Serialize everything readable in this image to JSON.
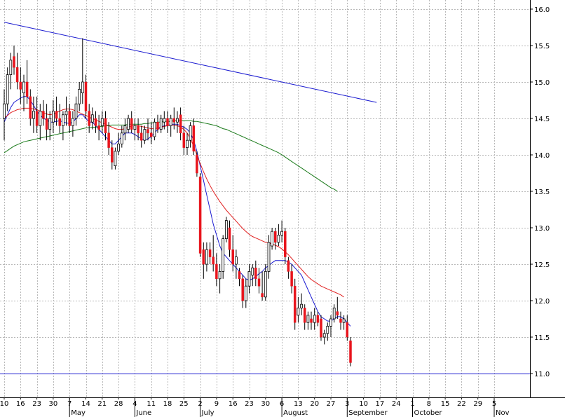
{
  "chart_data": {
    "type": "candlestick",
    "grid": true,
    "colors": {
      "up_candle": "#ffffff",
      "down_candle": "#e8141c",
      "ma_short": "#1a1ad0",
      "ma_mid": "#e02020",
      "ma_long": "#1a7a1a",
      "trendline": "#1a1ad0",
      "support_line": "#1a1ad0",
      "grid": "#b8b8b8"
    },
    "y_axis": {
      "ylim": [
        10.9,
        16.15
      ],
      "tick_labels": [
        "11.0",
        "11.5",
        "12.0",
        "12.5",
        "13.0",
        "13.5",
        "14.0",
        "14.5",
        "15.0",
        "15.5",
        "16.0"
      ],
      "tick_values": [
        11.0,
        11.5,
        12.0,
        12.5,
        13.0,
        13.5,
        14.0,
        14.5,
        15.0,
        15.5,
        16.0
      ]
    },
    "x_axis": {
      "day_labels": [
        "10",
        "16",
        "23",
        "30",
        "7",
        "14",
        "21",
        "28",
        "4",
        "11",
        "18",
        "25",
        "2",
        "9",
        "16",
        "23",
        "30",
        "6",
        "13",
        "20",
        "27",
        "3",
        "10",
        "17",
        "24",
        "1",
        "8",
        "15",
        "22",
        "29",
        "5"
      ],
      "month_labels": [
        {
          "label": "May",
          "day_index": 4
        },
        {
          "label": "June",
          "day_index": 8
        },
        {
          "label": "July",
          "day_index": 12
        },
        {
          "label": "August",
          "day_index": 17
        },
        {
          "label": "September",
          "day_index": 21
        },
        {
          "label": "October",
          "day_index": 25
        },
        {
          "label": "Nov",
          "day_index": 30
        }
      ],
      "bars_per_week": 5
    },
    "candles": [
      [
        14.5,
        14.9,
        14.2,
        14.7
      ],
      [
        14.7,
        15.2,
        14.6,
        15.1
      ],
      [
        15.1,
        15.4,
        14.9,
        15.3
      ],
      [
        15.35,
        15.5,
        15.1,
        15.2
      ],
      [
        15.2,
        15.4,
        14.9,
        15.0
      ],
      [
        15.0,
        15.2,
        14.7,
        14.9
      ],
      [
        14.85,
        15.1,
        14.6,
        15.0
      ],
      [
        15.0,
        15.3,
        14.7,
        14.8
      ],
      [
        14.8,
        14.9,
        14.4,
        14.5
      ],
      [
        14.5,
        14.8,
        14.3,
        14.6
      ],
      [
        14.6,
        14.8,
        14.3,
        14.4
      ],
      [
        14.4,
        14.7,
        14.2,
        14.6
      ],
      [
        14.6,
        14.75,
        14.4,
        14.5
      ],
      [
        14.5,
        14.7,
        14.2,
        14.35
      ],
      [
        14.35,
        14.6,
        14.2,
        14.5
      ],
      [
        14.45,
        14.75,
        14.3,
        14.6
      ],
      [
        14.6,
        14.8,
        14.4,
        14.5
      ],
      [
        14.5,
        14.7,
        14.3,
        14.4
      ],
      [
        14.4,
        14.6,
        14.2,
        14.55
      ],
      [
        14.55,
        14.8,
        14.4,
        14.6
      ],
      [
        14.6,
        14.7,
        14.3,
        14.4
      ],
      [
        14.4,
        14.6,
        14.25,
        14.5
      ],
      [
        14.5,
        14.8,
        14.4,
        14.7
      ],
      [
        14.7,
        15.0,
        14.6,
        14.9
      ],
      [
        14.85,
        15.6,
        14.7,
        15.0
      ],
      [
        15.0,
        15.1,
        14.5,
        14.6
      ],
      [
        14.6,
        14.7,
        14.3,
        14.4
      ],
      [
        14.45,
        14.65,
        14.35,
        14.55
      ],
      [
        14.5,
        14.6,
        14.3,
        14.4
      ],
      [
        14.4,
        14.55,
        14.2,
        14.35
      ],
      [
        14.4,
        14.6,
        14.3,
        14.5
      ],
      [
        14.5,
        14.6,
        14.2,
        14.3
      ],
      [
        14.3,
        14.45,
        14.0,
        14.1
      ],
      [
        14.1,
        14.2,
        13.8,
        13.9
      ],
      [
        13.85,
        14.1,
        13.8,
        14.05
      ],
      [
        14.05,
        14.3,
        14.0,
        14.15
      ],
      [
        14.15,
        14.4,
        14.1,
        14.3
      ],
      [
        14.3,
        14.5,
        14.2,
        14.4
      ],
      [
        14.35,
        14.55,
        14.3,
        14.5
      ],
      [
        14.5,
        14.6,
        14.3,
        14.35
      ],
      [
        14.35,
        14.5,
        14.2,
        14.4
      ],
      [
        14.4,
        14.5,
        14.2,
        14.3
      ],
      [
        14.3,
        14.4,
        14.1,
        14.2
      ],
      [
        14.2,
        14.4,
        14.15,
        14.35
      ],
      [
        14.35,
        14.5,
        14.2,
        14.3
      ],
      [
        14.3,
        14.45,
        14.15,
        14.25
      ],
      [
        14.25,
        14.5,
        14.2,
        14.45
      ],
      [
        14.45,
        14.55,
        14.3,
        14.35
      ],
      [
        14.35,
        14.55,
        14.3,
        14.5
      ],
      [
        14.45,
        14.6,
        14.35,
        14.5
      ],
      [
        14.5,
        14.6,
        14.3,
        14.4
      ],
      [
        14.4,
        14.55,
        14.25,
        14.5
      ],
      [
        14.5,
        14.65,
        14.35,
        14.45
      ],
      [
        14.45,
        14.6,
        14.3,
        14.5
      ],
      [
        14.55,
        14.65,
        14.2,
        14.3
      ],
      [
        14.3,
        14.4,
        14.0,
        14.1
      ],
      [
        14.1,
        14.3,
        14.0,
        14.2
      ],
      [
        14.2,
        14.45,
        14.1,
        14.4
      ],
      [
        14.4,
        14.5,
        14.0,
        14.05
      ],
      [
        14.0,
        14.05,
        13.7,
        13.75
      ],
      [
        13.7,
        13.75,
        12.6,
        12.65
      ],
      [
        12.7,
        12.8,
        12.3,
        12.5
      ],
      [
        12.5,
        12.8,
        12.4,
        12.7
      ],
      [
        12.7,
        12.8,
        12.5,
        12.6
      ],
      [
        12.6,
        12.9,
        12.4,
        12.5
      ],
      [
        12.5,
        12.65,
        12.2,
        12.3
      ],
      [
        12.3,
        12.5,
        12.1,
        12.4
      ],
      [
        12.4,
        12.9,
        12.3,
        12.85
      ],
      [
        12.85,
        13.15,
        12.8,
        13.1
      ],
      [
        13.0,
        13.1,
        12.6,
        12.7
      ],
      [
        12.7,
        12.9,
        12.4,
        12.5
      ],
      [
        12.5,
        12.7,
        12.3,
        12.6
      ],
      [
        12.4,
        12.45,
        12.2,
        12.3
      ],
      [
        12.3,
        12.35,
        11.9,
        12.0
      ],
      [
        12.0,
        12.3,
        11.9,
        12.2
      ],
      [
        12.2,
        12.5,
        12.1,
        12.4
      ],
      [
        12.35,
        12.5,
        12.2,
        12.45
      ],
      [
        12.45,
        12.55,
        12.2,
        12.3
      ],
      [
        12.3,
        12.45,
        12.1,
        12.2
      ],
      [
        12.1,
        12.4,
        12.0,
        12.05
      ],
      [
        12.05,
        12.5,
        12.0,
        12.4
      ],
      [
        12.4,
        12.9,
        12.3,
        12.8
      ],
      [
        12.75,
        13.0,
        12.7,
        12.95
      ],
      [
        12.95,
        13.0,
        12.7,
        12.8
      ],
      [
        12.8,
        13.05,
        12.75,
        12.9
      ],
      [
        12.9,
        13.1,
        12.8,
        12.95
      ],
      [
        12.95,
        13.0,
        12.5,
        12.6
      ],
      [
        12.55,
        12.6,
        12.3,
        12.4
      ],
      [
        12.4,
        12.5,
        12.1,
        12.2
      ],
      [
        12.2,
        12.3,
        11.6,
        11.7
      ],
      [
        11.8,
        12.05,
        11.7,
        11.9
      ],
      [
        11.9,
        12.1,
        11.8,
        11.95
      ],
      [
        11.9,
        11.95,
        11.6,
        11.7
      ],
      [
        11.7,
        11.85,
        11.6,
        11.8
      ],
      [
        11.75,
        11.85,
        11.6,
        11.7
      ],
      [
        11.7,
        11.9,
        11.6,
        11.8
      ],
      [
        11.8,
        11.85,
        11.65,
        11.7
      ],
      [
        11.75,
        11.8,
        11.45,
        11.5
      ],
      [
        11.5,
        11.6,
        11.4,
        11.55
      ],
      [
        11.55,
        11.7,
        11.45,
        11.65
      ],
      [
        11.65,
        11.8,
        11.5,
        11.75
      ],
      [
        11.75,
        11.95,
        11.7,
        11.9
      ],
      [
        11.85,
        12.05,
        11.75,
        11.8
      ],
      [
        11.75,
        11.85,
        11.6,
        11.7
      ],
      [
        11.7,
        11.8,
        11.6,
        11.75
      ],
      [
        11.7,
        11.8,
        11.45,
        11.5
      ],
      [
        11.45,
        11.5,
        11.1,
        11.15
      ]
    ],
    "moving_averages": [
      {
        "color_key": "ma_short",
        "start_index": 0,
        "values": [
          14.45,
          14.55,
          14.65,
          14.72,
          14.75,
          14.78,
          14.8,
          14.8,
          14.75,
          14.68,
          14.6,
          14.55,
          14.5,
          14.48,
          14.45,
          14.45,
          14.46,
          14.47,
          14.45,
          14.44,
          14.43,
          14.45,
          14.5,
          14.55,
          14.55,
          14.5,
          14.45,
          14.45,
          14.4,
          14.35,
          14.3,
          14.25,
          14.2,
          14.15,
          14.15,
          14.2,
          14.25,
          14.3,
          14.3,
          14.3,
          14.28,
          14.25,
          14.22,
          14.2,
          14.22,
          14.25,
          14.3,
          14.35,
          14.38,
          14.4,
          14.4,
          14.42,
          14.42,
          14.42,
          14.4,
          14.38,
          14.35,
          14.3,
          14.2,
          14.05,
          13.85,
          13.65,
          13.45,
          13.25,
          13.05,
          12.9,
          12.75,
          12.65,
          12.6,
          12.55,
          12.5,
          12.45,
          12.4,
          12.35,
          12.3,
          12.28,
          12.3,
          12.33,
          12.37,
          12.4,
          12.45,
          12.48,
          12.52,
          12.55,
          12.55,
          12.55,
          12.55,
          12.53,
          12.5,
          12.45,
          12.4,
          12.35,
          12.25,
          12.15,
          12.05,
          11.95,
          11.85,
          11.78,
          11.75,
          11.72,
          11.72,
          11.75,
          11.78,
          11.78,
          11.75,
          11.7,
          11.65
        ]
      },
      {
        "color_key": "ma_mid",
        "start_index": 0,
        "values": [
          14.5,
          14.54,
          14.58,
          14.6,
          14.62,
          14.63,
          14.64,
          14.64,
          14.64,
          14.63,
          14.62,
          14.6,
          14.58,
          14.56,
          14.55,
          14.56,
          14.58,
          14.6,
          14.62,
          14.63,
          14.63,
          14.62,
          14.6,
          14.58,
          14.56,
          14.54,
          14.52,
          14.5,
          14.48,
          14.46,
          14.44,
          14.42,
          14.4,
          14.38,
          14.36,
          14.35,
          14.35,
          14.36,
          14.38,
          14.4,
          14.4,
          14.4,
          14.39,
          14.38,
          14.37,
          14.36,
          14.36,
          14.37,
          14.38,
          14.39,
          14.4,
          14.41,
          14.41,
          14.4,
          14.38,
          14.35,
          14.3,
          14.22,
          14.12,
          14.0,
          13.88,
          13.77,
          13.67,
          13.58,
          13.5,
          13.43,
          13.36,
          13.3,
          13.24,
          13.19,
          13.14,
          13.09,
          13.04,
          12.99,
          12.95,
          12.91,
          12.88,
          12.86,
          12.84,
          12.82,
          12.8,
          12.79,
          12.78,
          12.76,
          12.74,
          12.71,
          12.67,
          12.63,
          12.58,
          12.53,
          12.48,
          12.43,
          12.38,
          12.33,
          12.29,
          12.26,
          12.23,
          12.2,
          12.18,
          12.16,
          12.14,
          12.12,
          12.1,
          12.08,
          12.05
        ]
      },
      {
        "color_key": "ma_long",
        "start_index": 0,
        "values": [
          14.03,
          14.06,
          14.09,
          14.12,
          14.14,
          14.16,
          14.18,
          14.19,
          14.2,
          14.21,
          14.22,
          14.23,
          14.24,
          14.25,
          14.26,
          14.27,
          14.28,
          14.29,
          14.3,
          14.31,
          14.32,
          14.33,
          14.34,
          14.35,
          14.36,
          14.37,
          14.37,
          14.38,
          14.38,
          14.39,
          14.39,
          14.4,
          14.4,
          14.41,
          14.41,
          14.41,
          14.41,
          14.41,
          14.42,
          14.42,
          14.42,
          14.42,
          14.42,
          14.43,
          14.43,
          14.44,
          14.44,
          14.45,
          14.45,
          14.46,
          14.46,
          14.46,
          14.47,
          14.47,
          14.47,
          14.47,
          14.47,
          14.47,
          14.46,
          14.46,
          14.45,
          14.44,
          14.43,
          14.42,
          14.41,
          14.4,
          14.38,
          14.36,
          14.35,
          14.33,
          14.31,
          14.29,
          14.27,
          14.25,
          14.23,
          14.21,
          14.19,
          14.17,
          14.15,
          14.13,
          14.11,
          14.09,
          14.07,
          14.05,
          14.03,
          14.0,
          13.97,
          13.94,
          13.91,
          13.88,
          13.85,
          13.82,
          13.79,
          13.76,
          13.73,
          13.7,
          13.67,
          13.64,
          13.61,
          13.58,
          13.55,
          13.53,
          13.5
        ]
      }
    ],
    "trendline": {
      "start_index": 0,
      "start_value": 15.82,
      "end_index": 114,
      "end_value": 14.72
    },
    "support_line": {
      "value": 11.0
    }
  }
}
